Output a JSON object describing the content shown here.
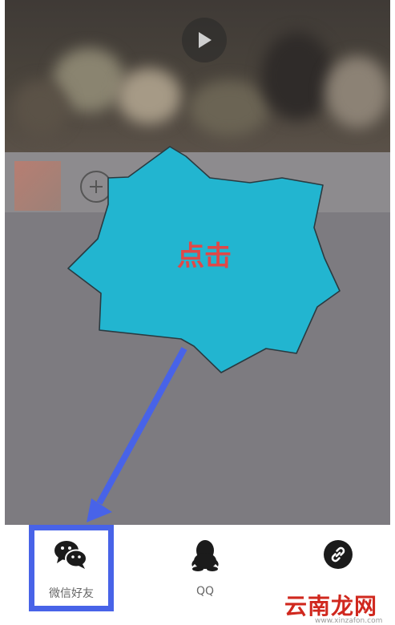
{
  "callout": {
    "text": "点击"
  },
  "share": {
    "items": [
      {
        "label": "微信好友",
        "icon": "wechat-icon"
      },
      {
        "label": "QQ",
        "icon": "qq-icon"
      },
      {
        "label": "",
        "icon": "link-icon"
      }
    ]
  },
  "watermark": {
    "brand": "云南龙网",
    "url": "www.xinzafon.com"
  },
  "colors": {
    "highlight": "#4863e8",
    "callout_fill": "#22b5d0",
    "callout_text": "#e04848",
    "arrow": "#4863e8",
    "dim_overlay": "#7d7b80"
  }
}
